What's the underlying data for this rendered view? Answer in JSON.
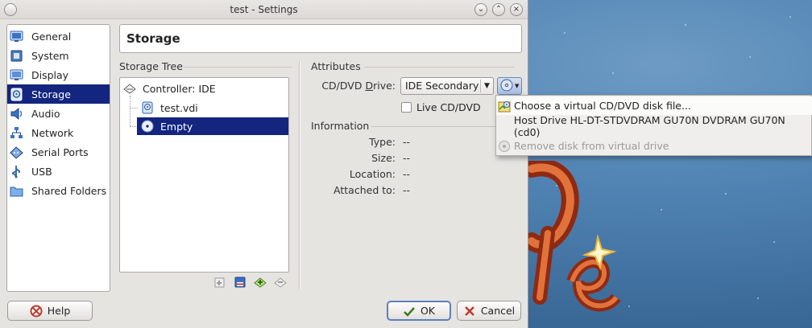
{
  "window": {
    "title": "test - Settings",
    "buttons": {
      "help": "⌄",
      "max": "⌃",
      "close": "×"
    }
  },
  "categories": [
    {
      "label": "General",
      "icon": "monitor-icon",
      "color": "#3b73c8"
    },
    {
      "label": "System",
      "icon": "chip-icon",
      "color": "#3a6aa8"
    },
    {
      "label": "Display",
      "icon": "display-icon",
      "color": "#3b73c8"
    },
    {
      "label": "Storage",
      "icon": "storage-icon",
      "color": "#3b73c8",
      "selected": true
    },
    {
      "label": "Audio",
      "icon": "audio-icon",
      "color": "#2f65b3"
    },
    {
      "label": "Network",
      "icon": "network-icon",
      "color": "#2f65b3"
    },
    {
      "label": "Serial Ports",
      "icon": "serial-icon",
      "color": "#3b73c8"
    },
    {
      "label": "USB",
      "icon": "usb-icon",
      "color": "#2f65b3"
    },
    {
      "label": "Shared Folders",
      "icon": "folder-icon",
      "color": "#5b8fcf"
    }
  ],
  "page": {
    "title": "Storage"
  },
  "tree": {
    "group_label": "Storage Tree",
    "controller": "Controller: IDE",
    "items": [
      {
        "label": "test.vdi",
        "icon": "hard-disk-icon"
      },
      {
        "label": "Empty",
        "icon": "cd-icon",
        "selected": true
      }
    ]
  },
  "attributes": {
    "group_label": "Attributes",
    "drive_label": "CD/DVD Drive:",
    "drive_mnemonic": "D",
    "drive_value": "IDE Secondary",
    "live_cd_label": "Live CD/DVD",
    "live_cd_checked": false
  },
  "information": {
    "group_label": "Information",
    "rows": [
      {
        "label": "Type:",
        "value": "--"
      },
      {
        "label": "Size:",
        "value": "--"
      },
      {
        "label": "Location:",
        "value": "--"
      },
      {
        "label": "Attached to:",
        "value": "--"
      }
    ]
  },
  "popup_menu": {
    "items": [
      {
        "label": "Choose a virtual CD/DVD disk file...",
        "icon": "choose-disk-icon",
        "hover": true
      },
      {
        "label": "Host Drive HL-DT-STDVDRAM GU70N DVDRAM GU70N (cd0)",
        "icon": ""
      },
      {
        "label": "Remove disk from virtual drive",
        "icon": "remove-disk-icon",
        "disabled": true
      }
    ]
  },
  "buttons": {
    "help": "Help",
    "ok": "OK",
    "cancel": "Cancel"
  }
}
